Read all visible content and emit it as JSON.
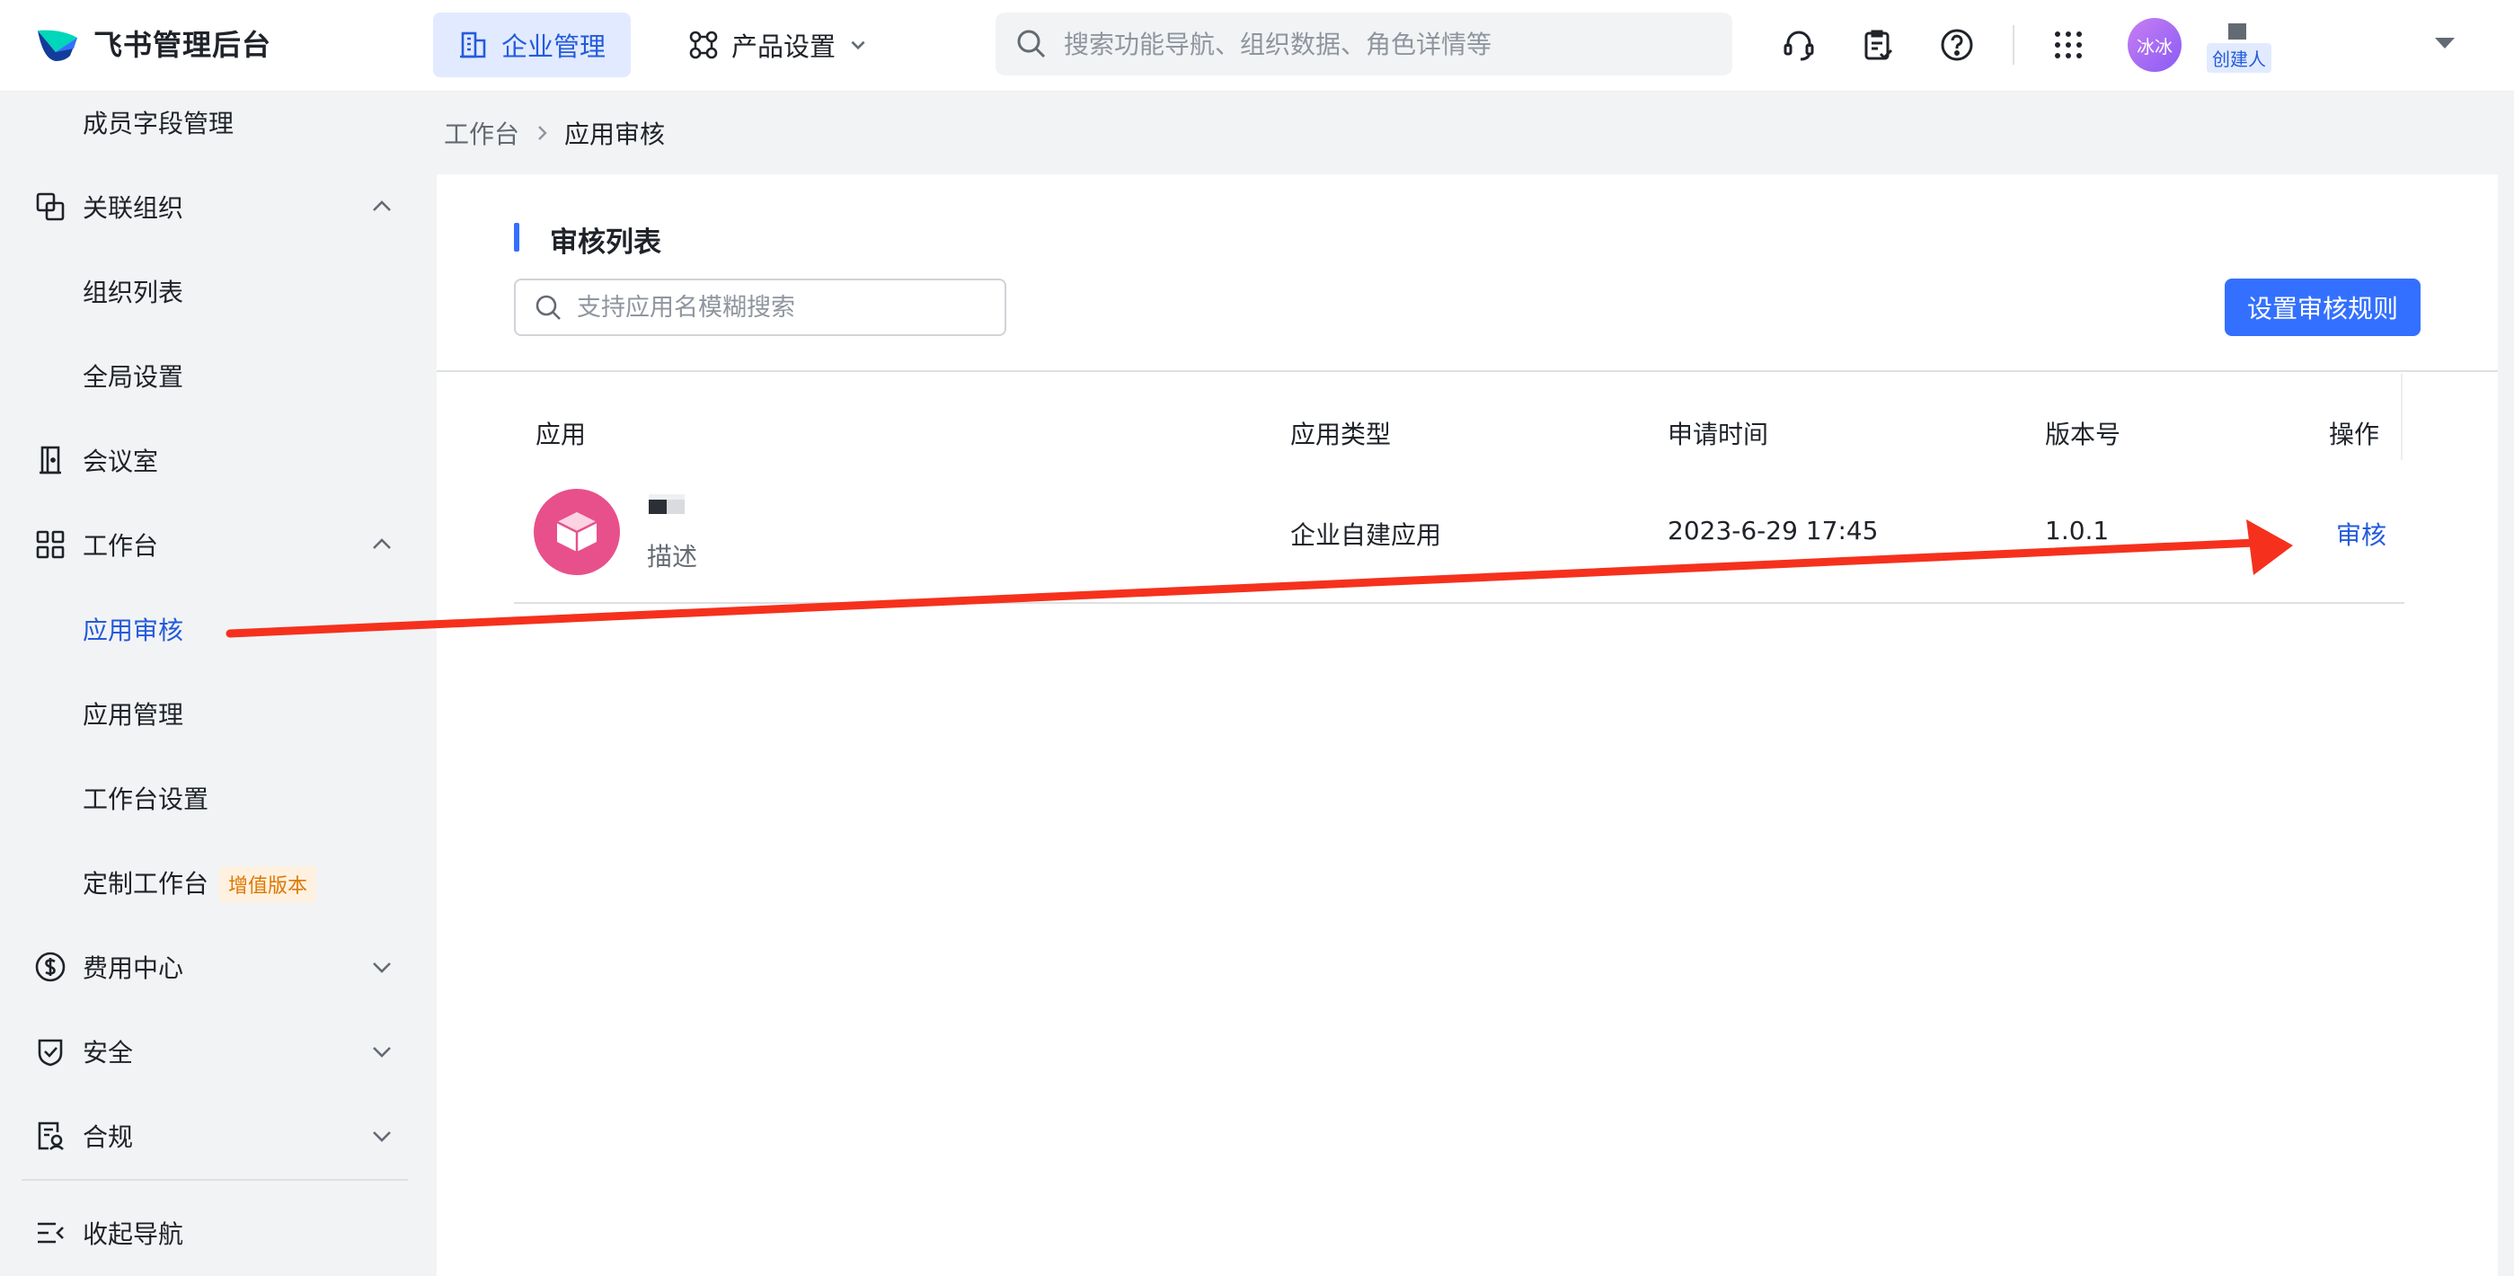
{
  "header": {
    "app_title": "飞书管理后台",
    "tabs": [
      {
        "label": "企业管理",
        "icon": "building-icon"
      },
      {
        "label": "产品设置",
        "icon": "product-settings-icon"
      }
    ],
    "search_placeholder": "搜索功能导航、组织数据、角色详情等",
    "icons": [
      "headset-icon",
      "clipboard-check-icon",
      "help-icon",
      "apps-grid-icon"
    ],
    "user": {
      "avatar_text": "冰冰",
      "role_tag": "创建人"
    }
  },
  "sidebar": {
    "items": [
      {
        "label": "成员字段管理"
      },
      {
        "label": "关联组织",
        "icon": "linked-org-icon",
        "expanded": true
      },
      {
        "label": "组织列表"
      },
      {
        "label": "全局设置"
      },
      {
        "label": "会议室",
        "icon": "meeting-room-icon"
      },
      {
        "label": "工作台",
        "icon": "workspace-grid-icon",
        "expanded": true
      },
      {
        "label": "应用审核",
        "active": true
      },
      {
        "label": "应用管理"
      },
      {
        "label": "工作台设置"
      },
      {
        "label": "定制工作台",
        "badge": "增值版本"
      },
      {
        "label": "费用中心",
        "icon": "dollar-icon",
        "expanded": false
      },
      {
        "label": "安全",
        "icon": "shield-icon",
        "expanded": false
      },
      {
        "label": "合规",
        "icon": "compliance-icon",
        "expanded": false
      }
    ],
    "collapse_label": "收起导航"
  },
  "breadcrumb": {
    "parent": "工作台",
    "current": "应用审核"
  },
  "main": {
    "title": "审核列表",
    "search_placeholder": "支持应用名模糊搜索",
    "primary_button": "设置审核规则",
    "table": {
      "headers": [
        "应用",
        "应用类型",
        "申请时间",
        "版本号",
        "操作"
      ],
      "rows": [
        {
          "app_desc": "描述",
          "type": "企业自建应用",
          "time": "2023-6-29 17:45",
          "version": "1.0.1",
          "action": "审核"
        }
      ]
    }
  },
  "colors": {
    "accent": "#3370ff",
    "link": "#245bdb",
    "annotation_arrow": "#f5311d",
    "app_avatar": "#e8508c"
  }
}
